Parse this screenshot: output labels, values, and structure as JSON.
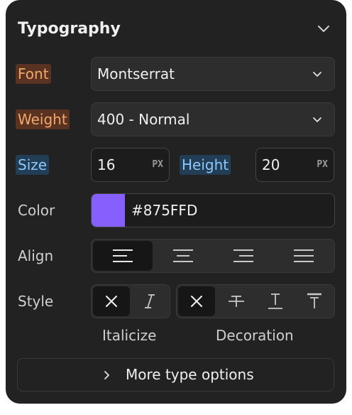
{
  "panel": {
    "title": "Typography",
    "collapse_icon": "chevron-down-icon"
  },
  "font": {
    "label": "Font",
    "value": "Montserrat"
  },
  "weight": {
    "label": "Weight",
    "value": "400 - Normal"
  },
  "size": {
    "label": "Size",
    "value": "16",
    "unit": "PX"
  },
  "height": {
    "label": "Height",
    "value": "20",
    "unit": "PX"
  },
  "color": {
    "label": "Color",
    "value": "#875FFD",
    "swatch": "#875FFD"
  },
  "align": {
    "label": "Align",
    "options": [
      "align-left-icon",
      "align-center-icon",
      "align-right-icon",
      "align-justify-icon"
    ],
    "selected": "align-left-icon"
  },
  "style": {
    "label": "Style",
    "italicize": {
      "caption": "Italicize",
      "options": [
        "none-x-icon",
        "italic-icon"
      ],
      "selected": "none-x-icon"
    },
    "decoration": {
      "caption": "Decoration",
      "options": [
        "none-x-icon",
        "strikethrough-icon",
        "underline-icon",
        "overline-icon"
      ],
      "selected": "none-x-icon"
    }
  },
  "more": {
    "label": "More type options",
    "icon": "chevron-right-icon"
  },
  "colors": {
    "panel_bg": "#222222",
    "label_orange": "#F2A76A",
    "label_blue": "#8EC7F7",
    "accent": "#875FFD"
  }
}
